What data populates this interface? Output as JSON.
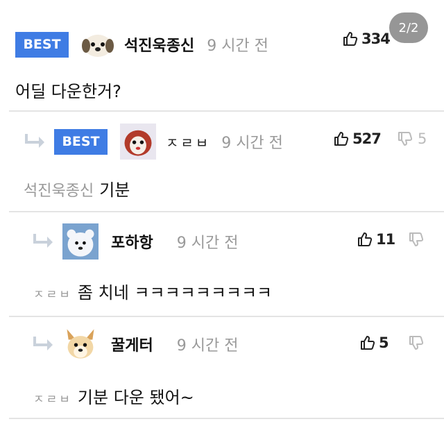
{
  "page_indicator": "2/2",
  "comments": [
    {
      "badge": "BEST",
      "nickname": "석진욱종신",
      "time": "9 시간 전",
      "likes": "334",
      "text": "어딜 다운한거?"
    },
    {
      "badge": "BEST",
      "nickname": "ㅈㄹㅂ",
      "time": "9 시간 전",
      "likes": "527",
      "dislikes": "5",
      "mention": "석진욱종신",
      "text": "기분"
    },
    {
      "nickname": "포하항",
      "time": "9 시간 전",
      "likes": "11",
      "mention": "ㅈㄹㅂ",
      "text": "좀 치네 ㅋㅋㅋㅋㅋㅋㅋㅋㅋ"
    },
    {
      "nickname": "꿀게터",
      "time": "9 시간 전",
      "likes": "5",
      "mention": "ㅈㄹㅂ",
      "text": "기분 다운 됐어~"
    }
  ],
  "colors": {
    "best_badge": "#3f7ce4",
    "muted": "#999999",
    "divider": "#e4e4e4"
  }
}
